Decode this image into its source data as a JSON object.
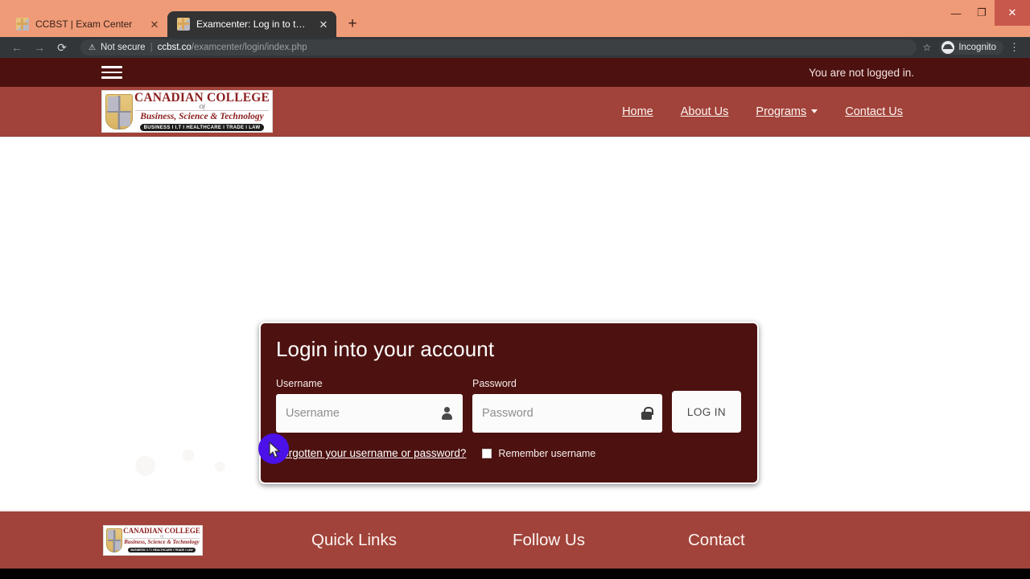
{
  "browser": {
    "tabs": [
      {
        "title": "CCBST | Exam Center",
        "active": false,
        "favicon": "ccbst-crest-icon"
      },
      {
        "title": "Examcenter: Log in to the site",
        "active": true,
        "favicon": "ccbst-crest-icon"
      }
    ],
    "new_tab_label": "+",
    "window_controls": {
      "minimize": "—",
      "maximize": "❐",
      "close": "✕"
    },
    "toolbar": {
      "back": "←",
      "forward": "→",
      "reload": "⟳",
      "security_label": "Not secure",
      "separator": "|",
      "url_host": "ccbst.co",
      "url_path": "/examcenter/login/index.php",
      "bookmark": "☆",
      "profile_label": "Incognito",
      "menu": "⋮"
    }
  },
  "site": {
    "topbar": {
      "menu_icon": "hamburger-icon",
      "login_status": "You are not logged in."
    },
    "logo": {
      "line1": "CANADIAN COLLEGE",
      "line2": "Of",
      "line3": "Business, Science & Technology",
      "line4": "BUSINESS I I.T I HEALTHCARE I TRADE I LAW"
    },
    "nav": [
      {
        "label": "Home",
        "has_caret": false
      },
      {
        "label": "About Us",
        "has_caret": false
      },
      {
        "label": "Programs",
        "has_caret": true
      },
      {
        "label": "Contact Us",
        "has_caret": false
      }
    ]
  },
  "login": {
    "title": "Login into your account",
    "username": {
      "label": "Username",
      "placeholder": "Username",
      "value": "",
      "icon": "user-icon"
    },
    "password": {
      "label": "Password",
      "placeholder": "Password",
      "value": "",
      "icon": "lock-icon"
    },
    "submit_label": "LOG IN",
    "forgot_label": "Forgotten your username or password?",
    "remember_label": "Remember username",
    "remember_checked": false
  },
  "footer": {
    "columns": [
      {
        "label": "Quick Links"
      },
      {
        "label": "Follow Us"
      },
      {
        "label": "Contact"
      }
    ]
  },
  "colors": {
    "dark_maroon": "#4d1210",
    "brick": "#a1433a",
    "tabstrip": "#ef9b78",
    "toolbar": "#323639",
    "click_highlight": "#4b11e8",
    "logo_red": "#8c1d1d"
  }
}
